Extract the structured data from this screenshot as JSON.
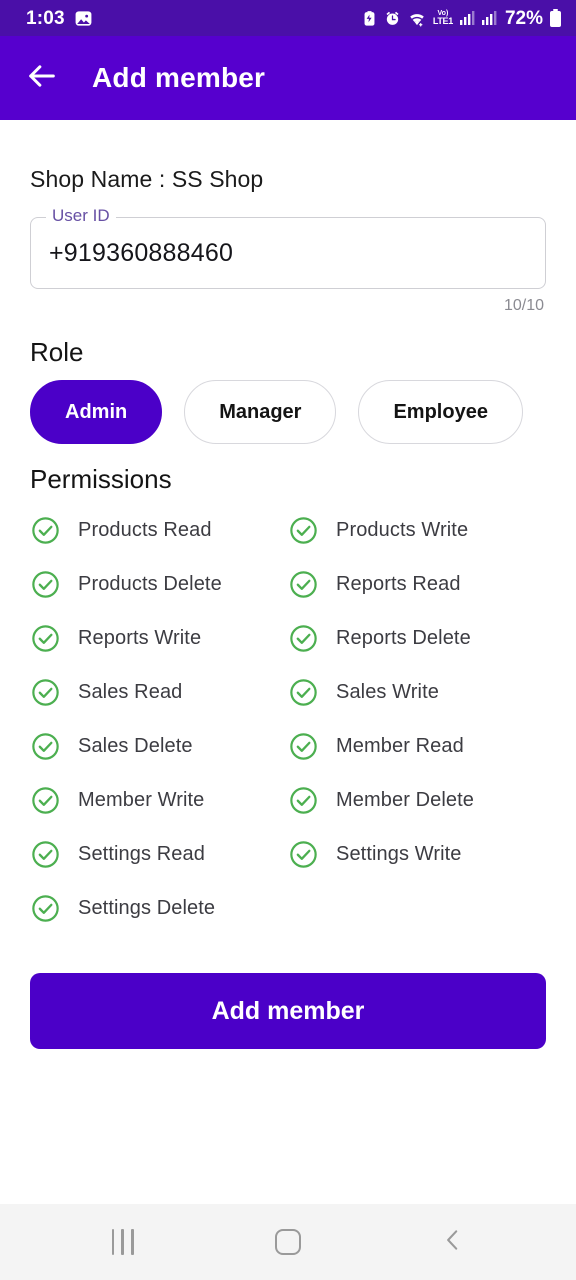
{
  "status_bar": {
    "time": "1:03",
    "battery_percent": "72%",
    "network_label_top": "Vo)",
    "network_label_bottom": "LTE1",
    "icons": [
      "photo-notification-icon",
      "battery-saver-icon",
      "alarm-icon",
      "wifi-icon",
      "volte-icon",
      "signal-sim1-icon",
      "signal-sim2-icon",
      "battery-icon"
    ],
    "background_color": "#4A0FA8"
  },
  "app_bar": {
    "title": "Add member",
    "back_icon": "arrow-left-icon",
    "background_color": "#5600CE"
  },
  "main": {
    "shop_name": "Shop Name : SS Shop",
    "user_id_field": {
      "label": "User ID",
      "value": "+919360888460",
      "placeholder": "User ID",
      "counter": "10/10",
      "label_color": "#6750A4"
    },
    "role": {
      "title": "Role",
      "selected": "Admin",
      "options": [
        {
          "label": "Admin",
          "selected": true
        },
        {
          "label": "Manager",
          "selected": false
        },
        {
          "label": "Employee",
          "selected": false
        }
      ],
      "selected_color": "#4B00C8"
    },
    "permissions": {
      "title": "Permissions",
      "check_color": "#4CAF50",
      "items": [
        {
          "label": "Products Read",
          "checked": true
        },
        {
          "label": "Products Write",
          "checked": true
        },
        {
          "label": "Products Delete",
          "checked": true
        },
        {
          "label": "Reports Read",
          "checked": true
        },
        {
          "label": "Reports Write",
          "checked": true
        },
        {
          "label": "Reports Delete",
          "checked": true
        },
        {
          "label": "Sales Read",
          "checked": true
        },
        {
          "label": "Sales Write",
          "checked": true
        },
        {
          "label": "Sales Delete",
          "checked": true
        },
        {
          "label": "Member Read",
          "checked": true
        },
        {
          "label": "Member Write",
          "checked": true
        },
        {
          "label": "Member Delete",
          "checked": true
        },
        {
          "label": "Settings Read",
          "checked": true
        },
        {
          "label": "Settings Write",
          "checked": true
        },
        {
          "label": "Settings Delete",
          "checked": true
        }
      ]
    },
    "submit_button": {
      "label": "Add member",
      "color": "#4B00C8"
    }
  },
  "nav_bar": {
    "recents_icon": "recents-icon",
    "home_icon": "home-icon",
    "back_icon": "chevron-left-icon"
  }
}
